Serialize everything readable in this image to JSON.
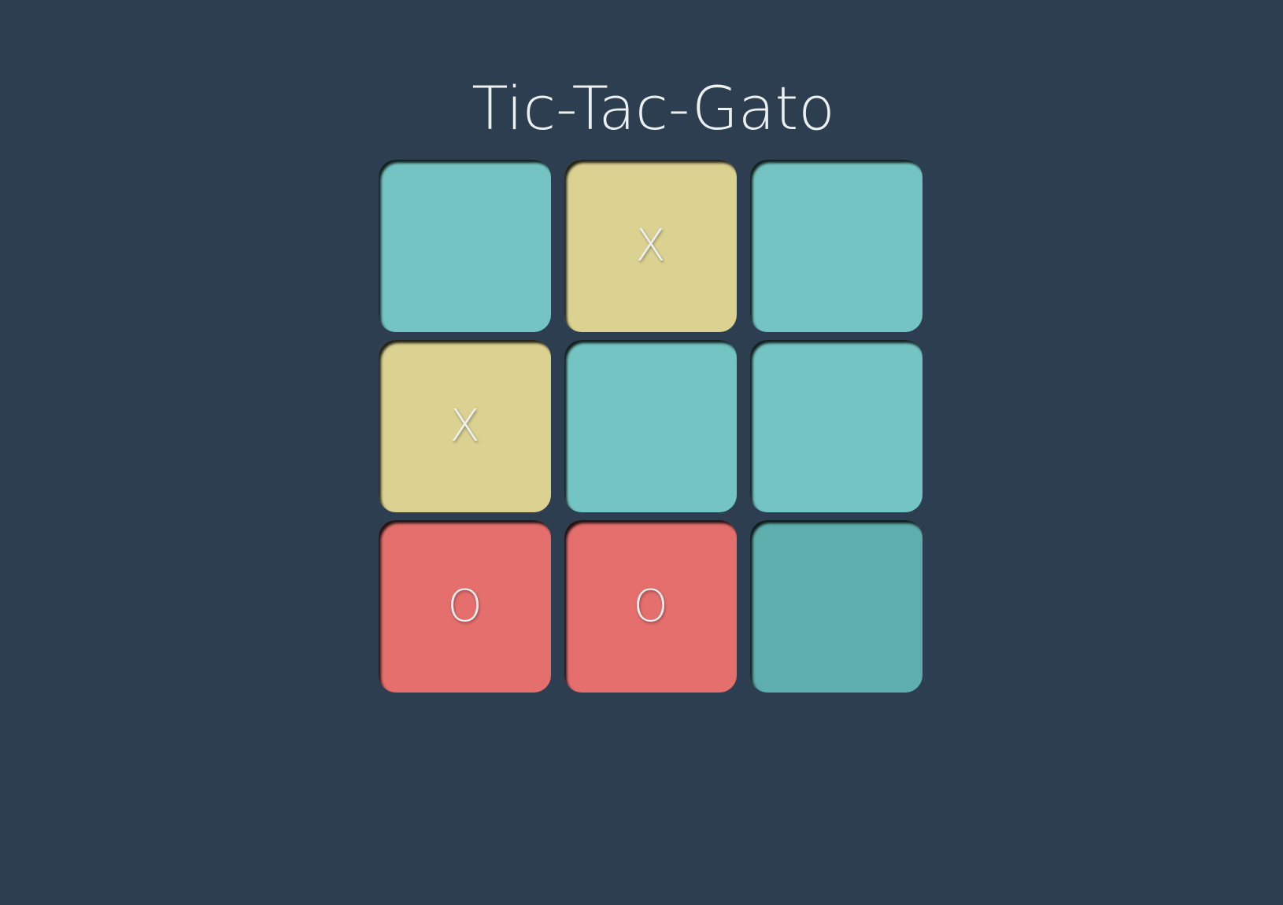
{
  "title": "Tic-Tac-Gato",
  "colors": {
    "background": "#2c3e50",
    "empty": "#74c4c3",
    "x": "#dbd191",
    "o": "#e46f6d",
    "hover": "#5eaeae",
    "text": "#ecf0f1"
  },
  "board": {
    "cells": [
      {
        "value": "",
        "state": "empty"
      },
      {
        "value": "X",
        "state": "x"
      },
      {
        "value": "",
        "state": "empty"
      },
      {
        "value": "X",
        "state": "x"
      },
      {
        "value": "",
        "state": "empty"
      },
      {
        "value": "",
        "state": "empty"
      },
      {
        "value": "O",
        "state": "o"
      },
      {
        "value": "O",
        "state": "o"
      },
      {
        "value": "",
        "state": "hover"
      }
    ]
  }
}
